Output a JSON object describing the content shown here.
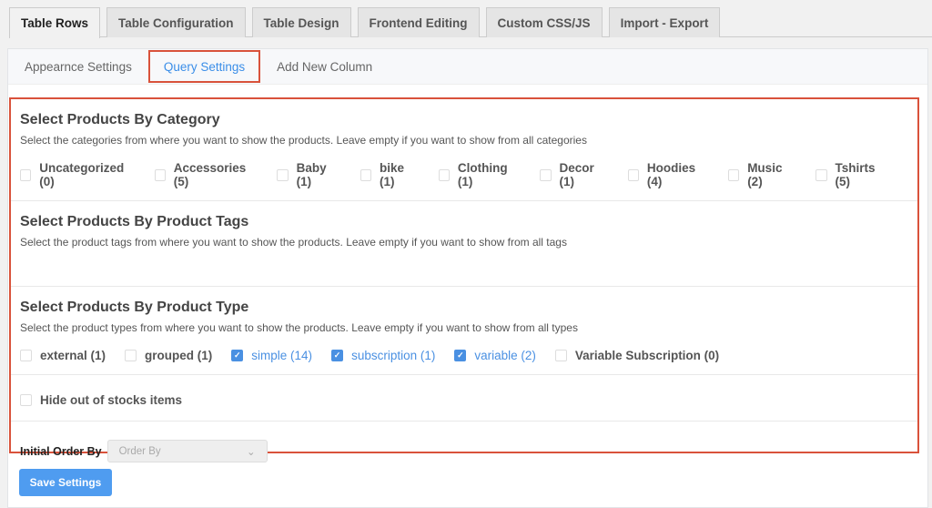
{
  "tabs": [
    "Table Rows",
    "Table Configuration",
    "Table Design",
    "Frontend Editing",
    "Custom CSS/JS",
    "Import - Export"
  ],
  "subtabs": [
    "Appearnce Settings",
    "Query Settings",
    "Add New Column"
  ],
  "category": {
    "title": "Select Products By Category",
    "desc": "Select the categories from where you want to show the products. Leave empty if you want to show from all categories",
    "options": [
      {
        "label": "Uncategorized (0)",
        "checked": false
      },
      {
        "label": "Accessories (5)",
        "checked": false
      },
      {
        "label": "Baby (1)",
        "checked": false
      },
      {
        "label": "bike (1)",
        "checked": false
      },
      {
        "label": "Clothing (1)",
        "checked": false
      },
      {
        "label": "Decor (1)",
        "checked": false
      },
      {
        "label": "Hoodies (4)",
        "checked": false
      },
      {
        "label": "Music (2)",
        "checked": false
      },
      {
        "label": "Tshirts (5)",
        "checked": false
      }
    ]
  },
  "tags": {
    "title": "Select Products By Product Tags",
    "desc": "Select the product tags from where you want to show the products. Leave empty if you want to show from all tags"
  },
  "type": {
    "title": "Select Products By Product Type",
    "desc": "Select the product types from where you want to show the products. Leave empty if you want to show from all types",
    "options": [
      {
        "label": "external (1)",
        "checked": false
      },
      {
        "label": "grouped (1)",
        "checked": false
      },
      {
        "label": "simple (14)",
        "checked": true
      },
      {
        "label": "subscription (1)",
        "checked": true
      },
      {
        "label": "variable (2)",
        "checked": true
      },
      {
        "label": "Variable Subscription (0)",
        "checked": false
      }
    ]
  },
  "hide_out_of_stock": {
    "label": "Hide out of stocks items",
    "checked": false
  },
  "order": {
    "label": "Initial Order By",
    "placeholder": "Order By"
  },
  "save_label": "Save Settings",
  "colors": {
    "accent": "#4a90e2",
    "highlight": "#d9523b"
  }
}
